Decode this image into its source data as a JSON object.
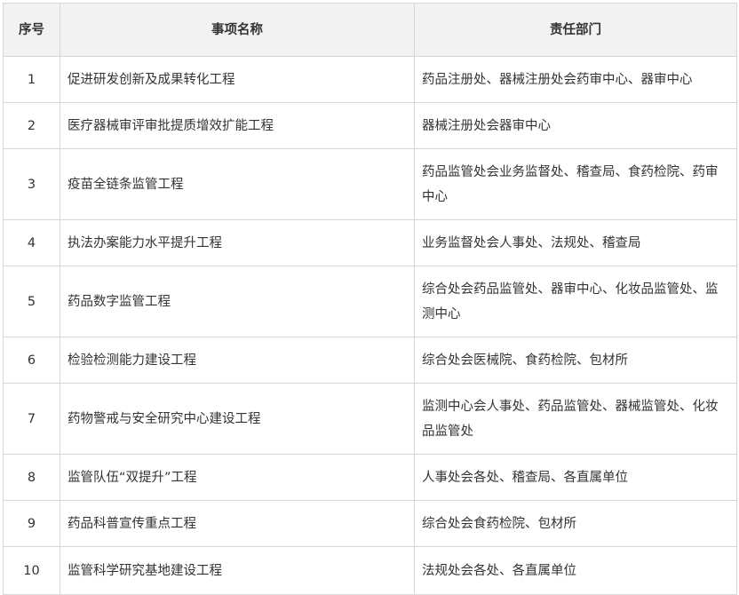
{
  "headers": {
    "no": "序号",
    "name": "事项名称",
    "dept": "责任部门"
  },
  "rows": [
    {
      "no": "1",
      "name": "促进研发创新及成果转化工程",
      "dept": "药品注册处、器械注册处会药审中心、器审中心"
    },
    {
      "no": "2",
      "name": "医疗器械审评审批提质增效扩能工程",
      "dept": "器械注册处会器审中心"
    },
    {
      "no": "3",
      "name": "疫苗全链条监管工程",
      "dept": "药品监管处会业务监督处、稽查局、食药检院、药审中心"
    },
    {
      "no": "4",
      "name": "执法办案能力水平提升工程",
      "dept": "业务监督处会人事处、法规处、稽查局"
    },
    {
      "no": "5",
      "name": "药品数字监管工程",
      "dept": "综合处会药品监管处、器审中心、化妆品监管处、监测中心"
    },
    {
      "no": "6",
      "name": "检验检测能力建设工程",
      "dept": "综合处会医械院、食药检院、包材所"
    },
    {
      "no": "7",
      "name": "药物警戒与安全研究中心建设工程",
      "dept": "监测中心会人事处、药品监管处、器械监管处、化妆品监管处"
    },
    {
      "no": "8",
      "name": "监管队伍“双提升”工程",
      "dept": "人事处会各处、稽查局、各直属单位"
    },
    {
      "no": "9",
      "name": "药品科普宣传重点工程",
      "dept": "综合处会食药检院、包材所"
    },
    {
      "no": "10",
      "name": "监管科学研究基地建设工程",
      "dept": "法规处会各处、各直属单位"
    }
  ]
}
